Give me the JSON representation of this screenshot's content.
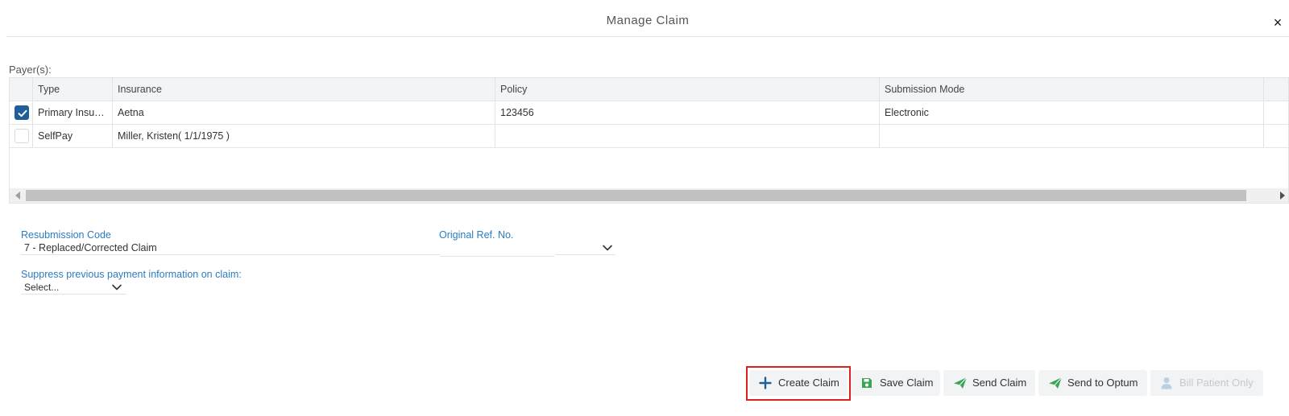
{
  "dialog": {
    "title": "Manage Claim",
    "close_symbol": "×"
  },
  "payers": {
    "label": "Payer(s):",
    "columns": [
      "Type",
      "Insurance",
      "Policy",
      "Submission Mode"
    ],
    "rows": [
      {
        "checked": true,
        "type": "Primary Insura...",
        "insurance": "Aetna",
        "policy": "123456",
        "submission_mode": "Electronic"
      },
      {
        "checked": false,
        "type": "SelfPay",
        "insurance": "Miller, Kristen( 1/1/1975 )",
        "policy": "",
        "submission_mode": ""
      }
    ]
  },
  "resubmission": {
    "label": "Resubmission Code",
    "value": "7 - Replaced/Corrected Claim"
  },
  "original_ref": {
    "label": "Original Ref. No.",
    "value": ""
  },
  "suppress": {
    "label": "Suppress previous payment information on claim:",
    "value": "Select..."
  },
  "buttons": {
    "create": {
      "label": "Create Claim",
      "icon": "plus-icon",
      "color": "#1f5f99"
    },
    "save": {
      "label": "Save Claim",
      "icon": "save-icon",
      "color": "#3aa655"
    },
    "send": {
      "label": "Send Claim",
      "icon": "send-icon",
      "color": "#3aa655"
    },
    "optum": {
      "label": "Send to Optum",
      "icon": "send-icon",
      "color": "#3aa655"
    },
    "bill": {
      "label": "Bill Patient Only",
      "icon": "user-icon",
      "disabled": true,
      "color": "#b9cfe4"
    }
  },
  "highlight_color": "#e02020"
}
